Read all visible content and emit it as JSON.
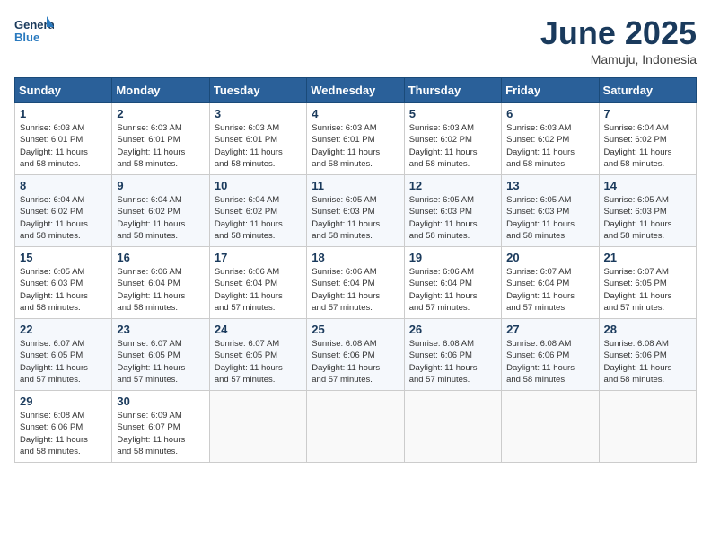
{
  "header": {
    "logo_line1": "General",
    "logo_line2": "Blue",
    "month": "June 2025",
    "location": "Mamuju, Indonesia"
  },
  "weekdays": [
    "Sunday",
    "Monday",
    "Tuesday",
    "Wednesday",
    "Thursday",
    "Friday",
    "Saturday"
  ],
  "weeks": [
    [
      {
        "day": "1",
        "sunrise": "6:03 AM",
        "sunset": "6:01 PM",
        "hours": "11",
        "minutes": "58"
      },
      {
        "day": "2",
        "sunrise": "6:03 AM",
        "sunset": "6:01 PM",
        "hours": "11",
        "minutes": "58"
      },
      {
        "day": "3",
        "sunrise": "6:03 AM",
        "sunset": "6:01 PM",
        "hours": "11",
        "minutes": "58"
      },
      {
        "day": "4",
        "sunrise": "6:03 AM",
        "sunset": "6:01 PM",
        "hours": "11",
        "minutes": "58"
      },
      {
        "day": "5",
        "sunrise": "6:03 AM",
        "sunset": "6:02 PM",
        "hours": "11",
        "minutes": "58"
      },
      {
        "day": "6",
        "sunrise": "6:03 AM",
        "sunset": "6:02 PM",
        "hours": "11",
        "minutes": "58"
      },
      {
        "day": "7",
        "sunrise": "6:04 AM",
        "sunset": "6:02 PM",
        "hours": "11",
        "minutes": "58"
      }
    ],
    [
      {
        "day": "8",
        "sunrise": "6:04 AM",
        "sunset": "6:02 PM",
        "hours": "11",
        "minutes": "58"
      },
      {
        "day": "9",
        "sunrise": "6:04 AM",
        "sunset": "6:02 PM",
        "hours": "11",
        "minutes": "58"
      },
      {
        "day": "10",
        "sunrise": "6:04 AM",
        "sunset": "6:02 PM",
        "hours": "11",
        "minutes": "58"
      },
      {
        "day": "11",
        "sunrise": "6:05 AM",
        "sunset": "6:03 PM",
        "hours": "11",
        "minutes": "58"
      },
      {
        "day": "12",
        "sunrise": "6:05 AM",
        "sunset": "6:03 PM",
        "hours": "11",
        "minutes": "58"
      },
      {
        "day": "13",
        "sunrise": "6:05 AM",
        "sunset": "6:03 PM",
        "hours": "11",
        "minutes": "58"
      },
      {
        "day": "14",
        "sunrise": "6:05 AM",
        "sunset": "6:03 PM",
        "hours": "11",
        "minutes": "58"
      }
    ],
    [
      {
        "day": "15",
        "sunrise": "6:05 AM",
        "sunset": "6:03 PM",
        "hours": "11",
        "minutes": "58"
      },
      {
        "day": "16",
        "sunrise": "6:06 AM",
        "sunset": "6:04 PM",
        "hours": "11",
        "minutes": "58"
      },
      {
        "day": "17",
        "sunrise": "6:06 AM",
        "sunset": "6:04 PM",
        "hours": "11",
        "minutes": "57"
      },
      {
        "day": "18",
        "sunrise": "6:06 AM",
        "sunset": "6:04 PM",
        "hours": "11",
        "minutes": "57"
      },
      {
        "day": "19",
        "sunrise": "6:06 AM",
        "sunset": "6:04 PM",
        "hours": "11",
        "minutes": "57"
      },
      {
        "day": "20",
        "sunrise": "6:07 AM",
        "sunset": "6:04 PM",
        "hours": "11",
        "minutes": "57"
      },
      {
        "day": "21",
        "sunrise": "6:07 AM",
        "sunset": "6:05 PM",
        "hours": "11",
        "minutes": "57"
      }
    ],
    [
      {
        "day": "22",
        "sunrise": "6:07 AM",
        "sunset": "6:05 PM",
        "hours": "11",
        "minutes": "57"
      },
      {
        "day": "23",
        "sunrise": "6:07 AM",
        "sunset": "6:05 PM",
        "hours": "11",
        "minutes": "57"
      },
      {
        "day": "24",
        "sunrise": "6:07 AM",
        "sunset": "6:05 PM",
        "hours": "11",
        "minutes": "57"
      },
      {
        "day": "25",
        "sunrise": "6:08 AM",
        "sunset": "6:06 PM",
        "hours": "11",
        "minutes": "57"
      },
      {
        "day": "26",
        "sunrise": "6:08 AM",
        "sunset": "6:06 PM",
        "hours": "11",
        "minutes": "57"
      },
      {
        "day": "27",
        "sunrise": "6:08 AM",
        "sunset": "6:06 PM",
        "hours": "11",
        "minutes": "58"
      },
      {
        "day": "28",
        "sunrise": "6:08 AM",
        "sunset": "6:06 PM",
        "hours": "11",
        "minutes": "58"
      }
    ],
    [
      {
        "day": "29",
        "sunrise": "6:08 AM",
        "sunset": "6:06 PM",
        "hours": "11",
        "minutes": "58"
      },
      {
        "day": "30",
        "sunrise": "6:09 AM",
        "sunset": "6:07 PM",
        "hours": "11",
        "minutes": "58"
      },
      null,
      null,
      null,
      null,
      null
    ]
  ]
}
